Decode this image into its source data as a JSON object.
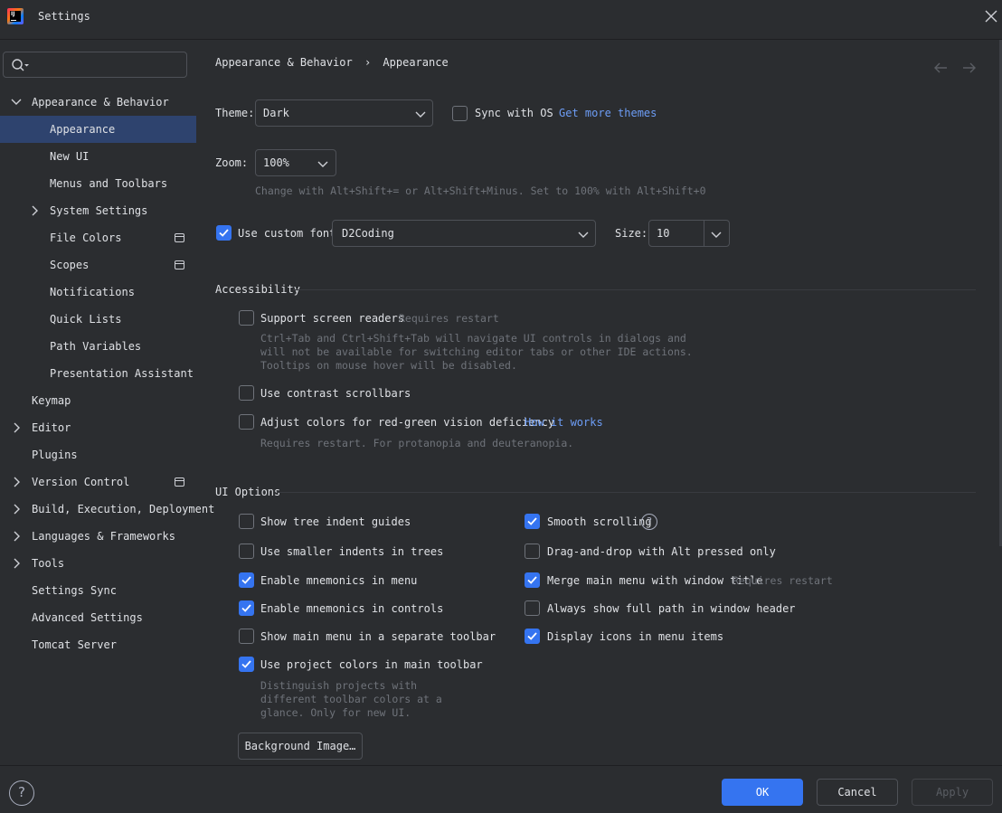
{
  "window": {
    "title": "Settings",
    "close_icon": "close-icon",
    "app_icon": "intellij-logo-icon"
  },
  "search": {
    "value": "",
    "placeholder": ""
  },
  "sidebar": {
    "items": [
      {
        "label": "Appearance & Behavior",
        "expandable": true,
        "expanded": true,
        "level": 0
      },
      {
        "label": "Appearance",
        "selected": true,
        "level": 1
      },
      {
        "label": "New UI",
        "level": 1
      },
      {
        "label": "Menus and Toolbars",
        "level": 1
      },
      {
        "label": "System Settings",
        "expandable": true,
        "level": 1
      },
      {
        "label": "File Colors",
        "level": 1,
        "project_icon": true
      },
      {
        "label": "Scopes",
        "level": 1,
        "project_icon": true
      },
      {
        "label": "Notifications",
        "level": 1
      },
      {
        "label": "Quick Lists",
        "level": 1
      },
      {
        "label": "Path Variables",
        "level": 1
      },
      {
        "label": "Presentation Assistant",
        "level": 1
      },
      {
        "label": "Keymap",
        "level": 0
      },
      {
        "label": "Editor",
        "expandable": true,
        "level": 0
      },
      {
        "label": "Plugins",
        "level": 0
      },
      {
        "label": "Version Control",
        "expandable": true,
        "level": 0,
        "project_icon": true
      },
      {
        "label": "Build, Execution, Deployment",
        "expandable": true,
        "level": 0
      },
      {
        "label": "Languages & Frameworks",
        "expandable": true,
        "level": 0
      },
      {
        "label": "Tools",
        "expandable": true,
        "level": 0
      },
      {
        "label": "Settings Sync",
        "level": 0
      },
      {
        "label": "Advanced Settings",
        "level": 0
      },
      {
        "label": "Tomcat Server",
        "level": 0
      }
    ]
  },
  "breadcrumb": {
    "parent": "Appearance & Behavior",
    "separator": "›",
    "current": "Appearance"
  },
  "theme": {
    "label": "Theme:",
    "value": "Dark",
    "sync_label": "Sync with OS",
    "sync_checked": false,
    "get_more": "Get more themes"
  },
  "zoom": {
    "label": "Zoom:",
    "value": "100%",
    "hint": "Change with Alt+Shift+= or Alt+Shift+Minus. Set to 100% with Alt+Shift+0"
  },
  "font": {
    "use_custom_label": "Use custom font:",
    "checked": true,
    "value": "D2Coding",
    "size_label": "Size:",
    "size_value": "10"
  },
  "accessibility": {
    "title": "Accessibility",
    "screen_readers": {
      "label": "Support screen readers",
      "checked": false,
      "note": "Requires restart",
      "desc": [
        "Ctrl+Tab and Ctrl+Shift+Tab will navigate UI controls in dialogs and",
        "will not be available for switching editor tabs or other IDE actions.",
        "Tooltips on mouse hover will be disabled."
      ]
    },
    "contrast_scrollbars": {
      "label": "Use contrast scrollbars",
      "checked": false
    },
    "color_deficiency": {
      "label": "Adjust colors for red-green vision deficiency",
      "checked": false,
      "link": "How it works",
      "desc": "Requires restart. For protanopia and deuteranopia."
    }
  },
  "ui_options": {
    "title": "UI Options",
    "left": [
      {
        "label": "Show tree indent guides",
        "checked": false
      },
      {
        "label": "Use smaller indents in trees",
        "checked": false
      },
      {
        "label": "Enable mnemonics in menu",
        "checked": true
      },
      {
        "label": "Enable mnemonics in controls",
        "checked": true
      },
      {
        "label": "Show main menu in a separate toolbar",
        "checked": false
      },
      {
        "label": "Use project colors in main toolbar",
        "checked": true
      }
    ],
    "project_colors_desc": [
      "Distinguish projects with",
      "different toolbar colors at a",
      "glance. Only for new UI."
    ],
    "right": [
      {
        "label": "Smooth scrolling",
        "checked": true,
        "help": "?"
      },
      {
        "label": "Drag-and-drop with Alt pressed only",
        "checked": false
      },
      {
        "label": "Merge main menu with window title",
        "checked": true,
        "note": "Requires restart"
      },
      {
        "label": "Always show full path in window header",
        "checked": false
      },
      {
        "label": "Display icons in menu items",
        "checked": true
      }
    ],
    "background_image_button": "Background Image…"
  },
  "footer": {
    "help": "?",
    "ok": "OK",
    "cancel": "Cancel",
    "apply": "Apply"
  },
  "colors": {
    "accent": "#3574f0",
    "link": "#6d9df6",
    "selection": "#2e436e",
    "background": "#2b2d30"
  }
}
